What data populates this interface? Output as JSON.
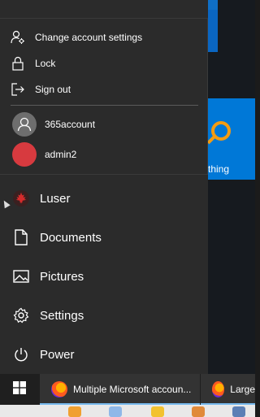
{
  "account_menu": {
    "items": [
      {
        "label": "Change account settings",
        "icon": "account-settings-icon"
      },
      {
        "label": "Lock",
        "icon": "lock-icon"
      },
      {
        "label": "Sign out",
        "icon": "sign-out-icon"
      }
    ],
    "users": [
      {
        "name": "365account",
        "avatar": "default-user-avatar",
        "color": "#6e6e6e"
      },
      {
        "name": "admin2",
        "avatar": "red-avatar",
        "color": "#d73a3f"
      }
    ]
  },
  "start_menu": {
    "items": [
      {
        "label": "Luser",
        "icon": "maple-leaf-avatar-icon"
      },
      {
        "label": "Documents",
        "icon": "document-icon"
      },
      {
        "label": "Pictures",
        "icon": "pictures-icon"
      },
      {
        "label": "Settings",
        "icon": "gear-icon"
      },
      {
        "label": "Power",
        "icon": "power-icon"
      }
    ]
  },
  "tile": {
    "label": "thing"
  },
  "taskbar": {
    "apps": [
      {
        "label": "Multiple Microsoft accoun...",
        "icon": "firefox-icon"
      },
      {
        "label": "Large",
        "icon": "firefox-icon"
      }
    ]
  },
  "colors": {
    "menu_bg": "#2b2b2b",
    "taskbar_bg": "#1f1f1f",
    "tile_blue": "#0078d7",
    "accent": "#76b9ed"
  }
}
